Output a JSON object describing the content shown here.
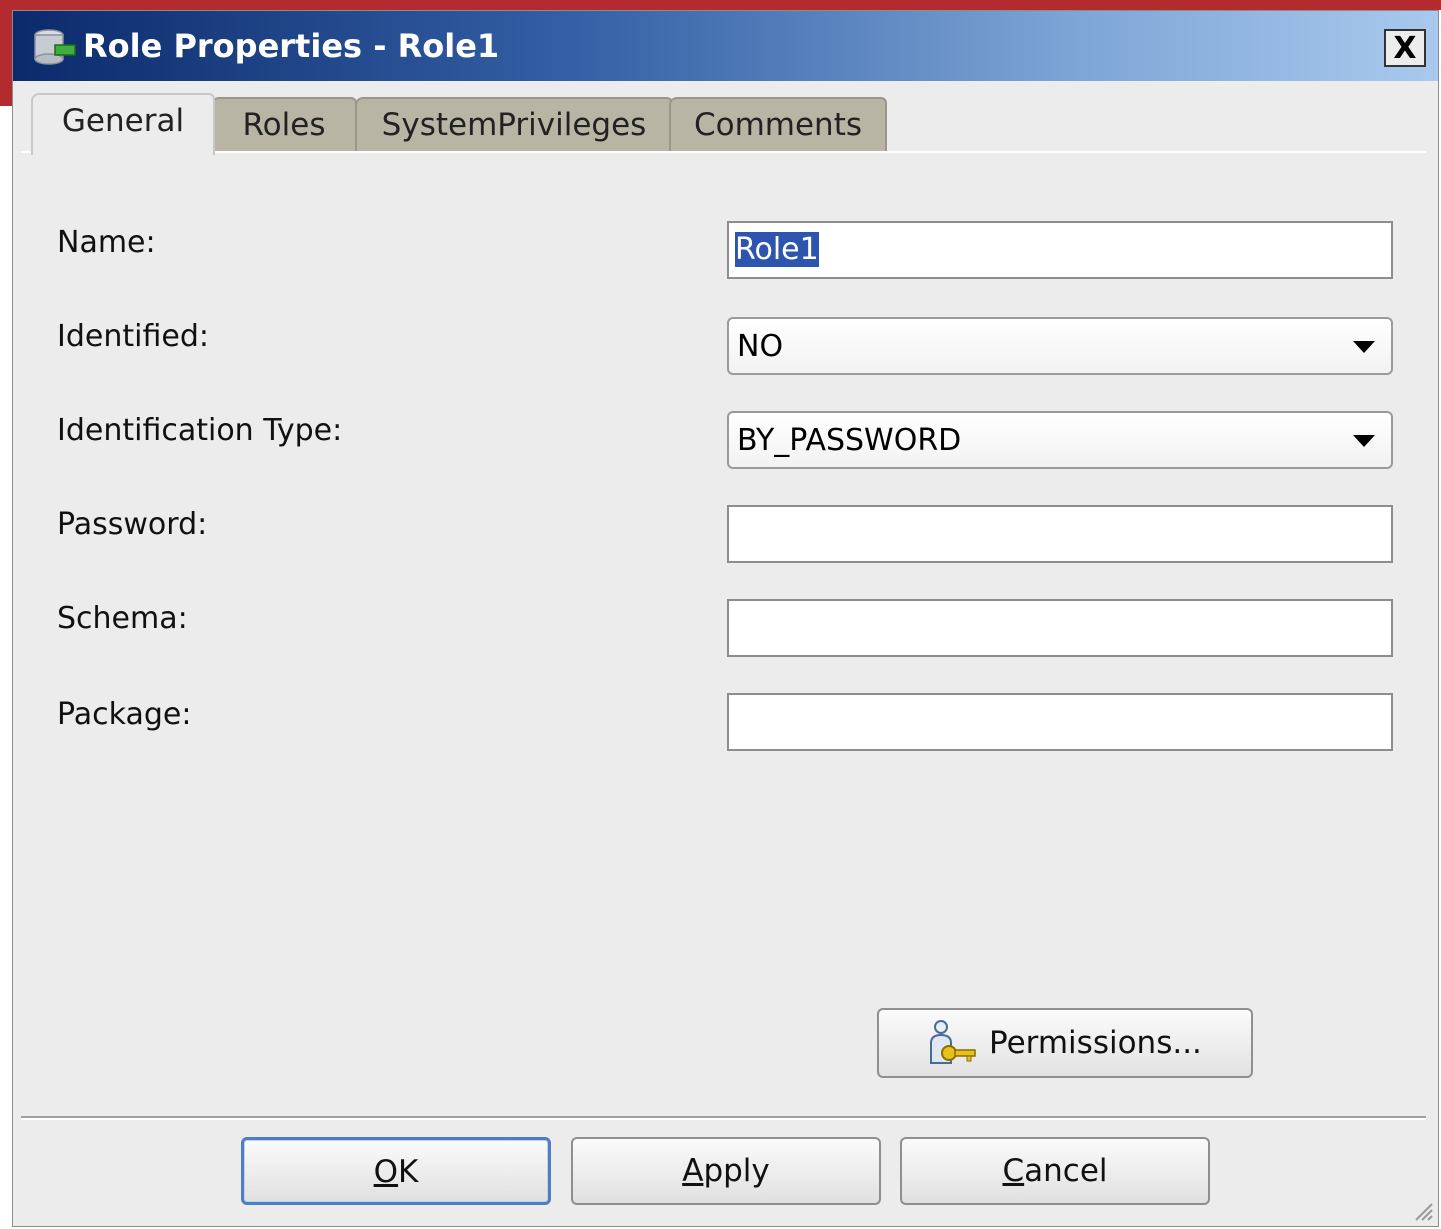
{
  "window": {
    "title": "Role Properties - Role1",
    "close_label": "X"
  },
  "tabs": [
    {
      "label": "General",
      "active": true
    },
    {
      "label": "Roles",
      "active": false
    },
    {
      "label": "SystemPrivileges",
      "active": false
    },
    {
      "label": "Comments",
      "active": false
    }
  ],
  "form": {
    "name": {
      "label": "Name:",
      "value": "Role1"
    },
    "identified": {
      "label": "Identified:",
      "value": "NO"
    },
    "identification_type": {
      "label": "Identification Type:",
      "value": "BY_PASSWORD"
    },
    "password": {
      "label": "Password:",
      "value": ""
    },
    "schema": {
      "label": "Schema:",
      "value": ""
    },
    "package": {
      "label": "Package:",
      "value": ""
    }
  },
  "permissions_button": {
    "label": "Permissions...",
    "icon": "user-key-icon"
  },
  "buttons": {
    "ok": {
      "mnemonic": "O",
      "rest": "K"
    },
    "apply": {
      "mnemonic": "A",
      "rest": "pply"
    },
    "cancel": {
      "mnemonic": "C",
      "rest": "ancel"
    }
  },
  "colors": {
    "title_gradient_start": "#0b2a6b",
    "title_gradient_end": "#a9c9ee",
    "selection": "#2d55b0",
    "inactive_tab": "#b9b5a4"
  }
}
